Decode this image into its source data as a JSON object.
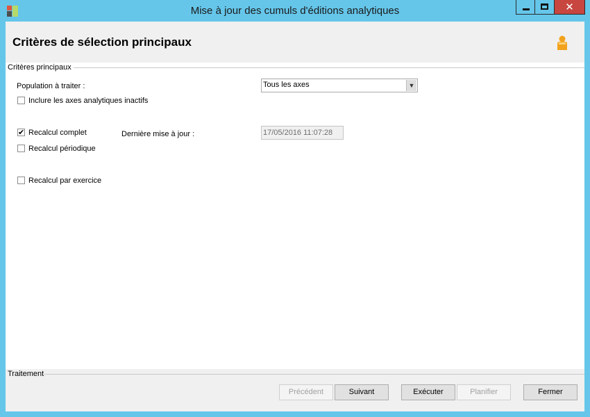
{
  "window": {
    "title": "Mise à jour des cumuls d'éditions analytiques",
    "controls": {
      "minimize": "minimize-icon",
      "maximize": "maximize-icon",
      "close_glyph": "✕"
    }
  },
  "header": {
    "title": "Critères de sélection principaux",
    "icon": "user-icon"
  },
  "main_group": {
    "label": "Critères principaux",
    "population_label": "Population à traiter :",
    "population_value": "Tous les axes",
    "include_inactive_label": "Inclure les axes analytiques inactifs",
    "include_inactive_checked": false,
    "recalc_complet_label": "Recalcul complet",
    "recalc_complet_checked": true,
    "checkmark": "✔",
    "recalc_periodique_label": "Recalcul périodique",
    "recalc_periodique_checked": false,
    "recalc_exercice_label": "Recalcul par exercice",
    "recalc_exercice_checked": false,
    "last_update_label": "Dernière mise à jour :",
    "last_update_value": "17/05/2016 11:07:28"
  },
  "footer": {
    "label": "Traitement",
    "buttons": {
      "previous": "Précédent",
      "next": "Suivant",
      "execute": "Exécuter",
      "schedule": "Planifier",
      "close": "Fermer"
    }
  },
  "colors": {
    "titlebar": "#65c6ea",
    "close_button": "#c7463f",
    "panel": "#f0f0f0"
  }
}
